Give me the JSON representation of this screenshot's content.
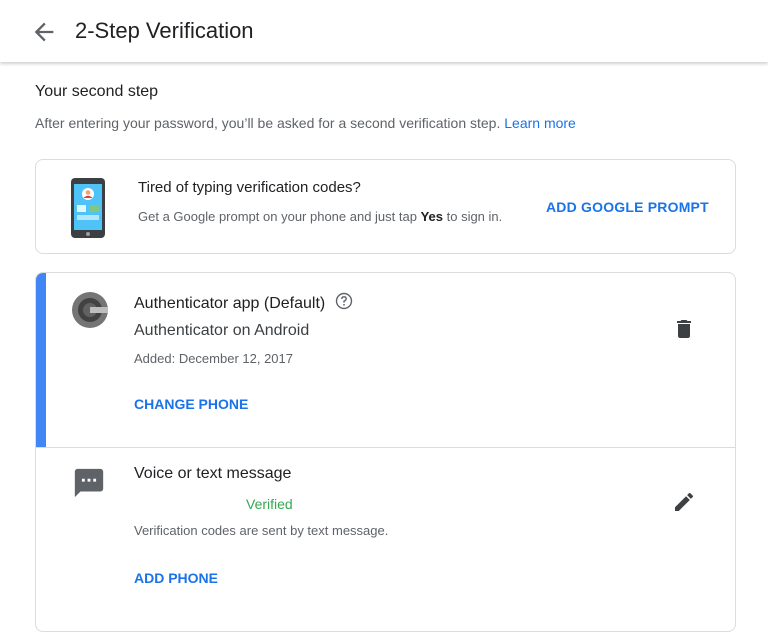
{
  "header": {
    "title": "2-Step Verification",
    "back_icon": "arrow-back-icon"
  },
  "section": {
    "title": "Your second step",
    "description": "After entering your password, you’ll be asked for a second verification step.",
    "learn_more": "Learn more"
  },
  "promo": {
    "title": "Tired of typing verification codes?",
    "desc_before": "Get a Google prompt on your phone and just tap ",
    "desc_bold": "Yes",
    "desc_after": " to sign in.",
    "button": "ADD GOOGLE PROMPT",
    "icon": "phone-illustration-icon"
  },
  "authenticator": {
    "title": "Authenticator app (Default)",
    "device": "Authenticator on Android",
    "added": "Added: December 12, 2017",
    "button": "CHANGE PHONE",
    "icon": "authenticator-icon",
    "help_icon": "help-circle-icon",
    "delete_icon": "trash-icon"
  },
  "sms": {
    "title": "Voice or text message",
    "status": "Verified",
    "description": "Verification codes are sent by text message.",
    "button": "ADD PHONE",
    "icon": "message-icon",
    "edit_icon": "pencil-icon"
  },
  "colors": {
    "accent": "#1a73e8",
    "blue_bar": "#4285f4",
    "verified": "#34a853"
  }
}
